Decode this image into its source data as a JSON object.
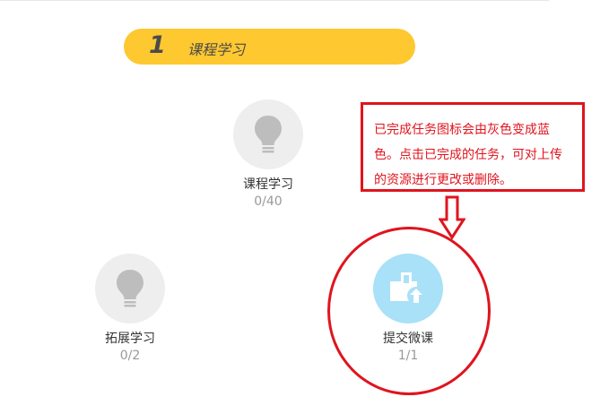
{
  "section": {
    "number": "1",
    "title": "课程学习"
  },
  "nodes": {
    "course": {
      "label": "课程学习",
      "count": "0/40",
      "icon": "lightbulb-icon",
      "state": "incomplete"
    },
    "extension": {
      "label": "拓展学习",
      "count": "0/2",
      "icon": "lightbulb-icon",
      "state": "incomplete"
    },
    "submit": {
      "label": "提交微课",
      "count": "1/1",
      "icon": "upload-icon",
      "state": "complete"
    }
  },
  "annotation": {
    "text": "已完成任务图标会由灰色变成蓝色。点击已完成的任务，可对上传的资源进行更改或删除。"
  },
  "colors": {
    "banner": "#fdc830",
    "incomplete_circle": "#eeeeee",
    "complete_circle": "#a8e1f8",
    "annotation": "#e0141e"
  }
}
